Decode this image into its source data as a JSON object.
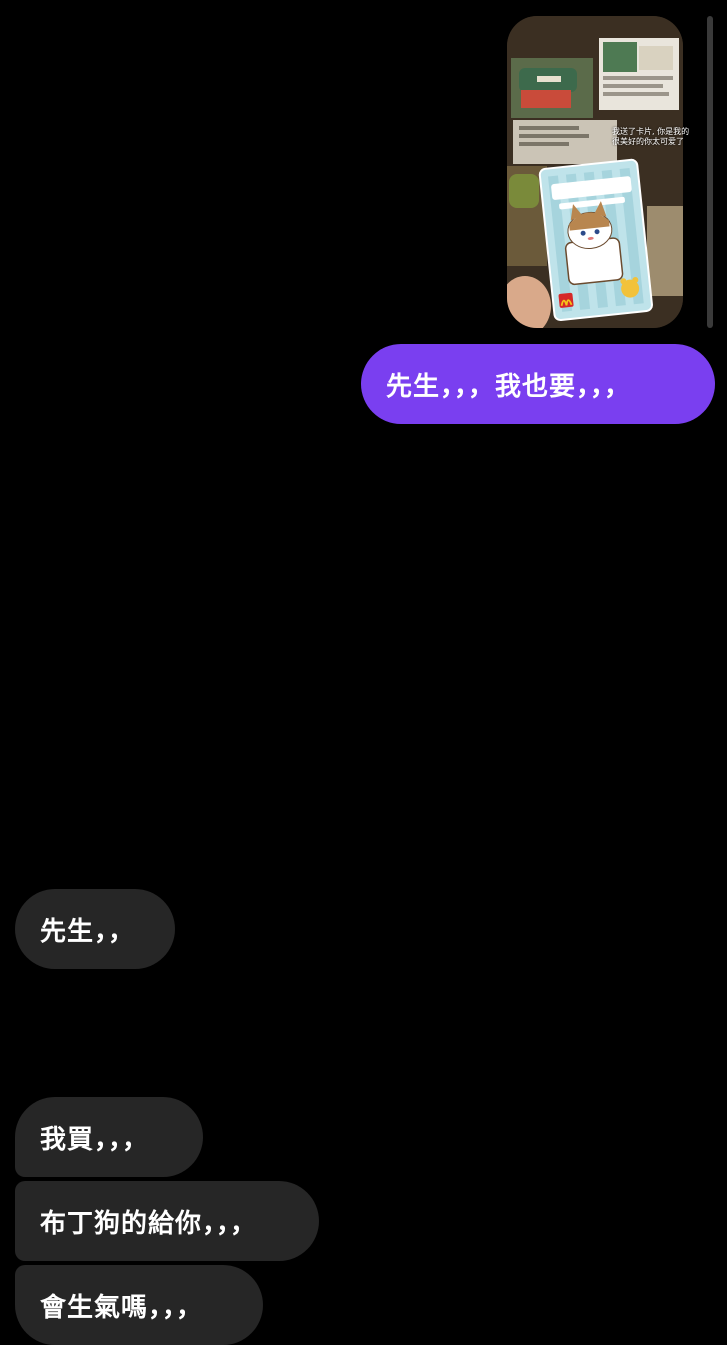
{
  "shared_post": {
    "image_label": "shared-post-preview",
    "caption_lines": [
      "我送了卡片, 你是我的",
      "很美好的你太可爱了"
    ],
    "card_title": "Sanrio characters"
  },
  "messages": {
    "sent": [
      {
        "text": "先生，，，我也要，，，"
      }
    ],
    "received": [
      {
        "text": "先生，，"
      },
      {
        "text": "我買，，，"
      },
      {
        "text": "布丁狗的給你，，，"
      },
      {
        "text": "會生氣嗎，，，"
      }
    ]
  },
  "colors": {
    "background": "#000000",
    "sent_bubble": "#7a3ff0",
    "received_bubble": "#262626",
    "text": "#ffffff"
  }
}
